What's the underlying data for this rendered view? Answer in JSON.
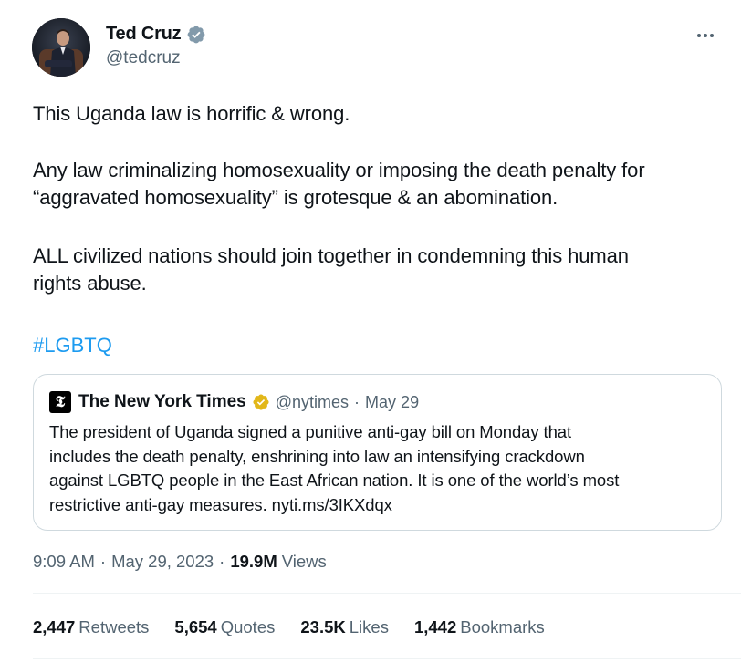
{
  "author": {
    "name": "Ted Cruz",
    "handle": "@tedcruz",
    "verified_color": "#829aab"
  },
  "more_icon": "more-horizontal-icon",
  "tweet": {
    "paragraph_1": "This Uganda law is horrific & wrong.",
    "paragraph_2_line_1": "Any law criminalizing homosexuality or imposing the death penalty for",
    "paragraph_2_line_2": "“aggravated homosexuality” is grotesque & an abomination.",
    "paragraph_3_line_1": "ALL civilized nations should join together in condemning this human",
    "paragraph_3_line_2": "rights abuse.",
    "hashtag": "#LGBTQ",
    "link_color": "#1d9bf0"
  },
  "quoted_tweet": {
    "logo_glyph": "𝕿",
    "name": "The New York Times",
    "badge_color": "#e2b719",
    "handle": "@nytimes",
    "dot": "·",
    "date": "May 29",
    "line_1": "The president of Uganda signed a punitive anti-gay bill on Monday that",
    "line_2": "includes the death penalty, enshrining into law an intensifying crackdown",
    "line_3": "against LGBTQ people in the East African nation. It is one of the world’s most",
    "line_4": "restrictive anti-gay measures. nyti.ms/3IKXdqx"
  },
  "meta": {
    "time": "9:09 AM",
    "sep1": "·",
    "date": "May 29, 2023",
    "sep2": "·",
    "views_count": "19.9M",
    "views_label": "Views"
  },
  "stats": [
    {
      "count": "2,447",
      "label": "Retweets"
    },
    {
      "count": "5,654",
      "label": "Quotes"
    },
    {
      "count": "23.5K",
      "label": "Likes"
    },
    {
      "count": "1,442",
      "label": "Bookmarks"
    }
  ]
}
